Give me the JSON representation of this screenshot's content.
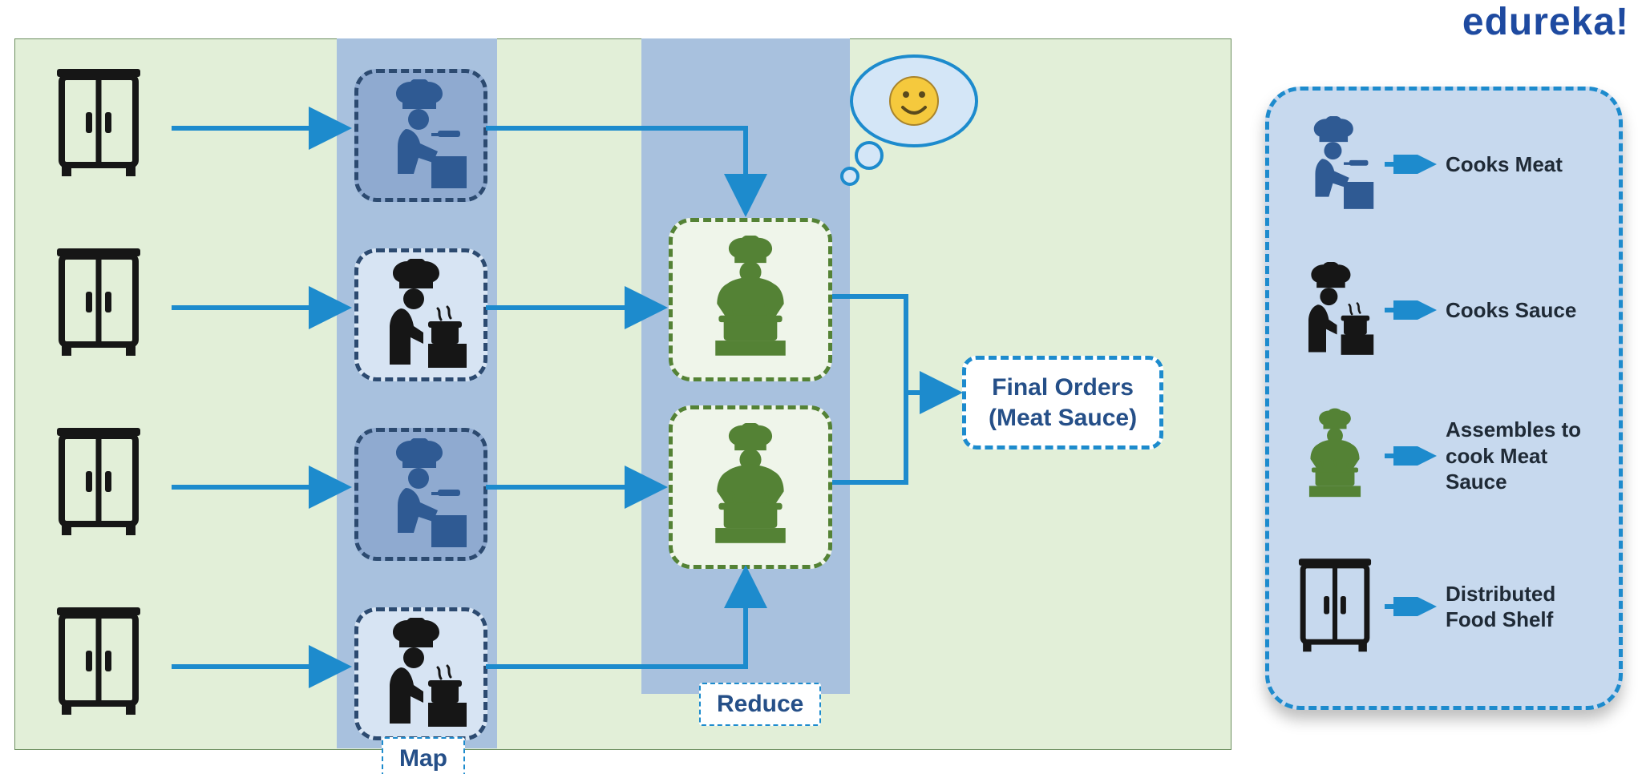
{
  "brand": "edureka!",
  "labels": {
    "map": "Map",
    "reduce": "Reduce",
    "final_l1": "Final Orders",
    "final_l2": "(Meat Sauce)"
  },
  "legend": [
    {
      "icon": "chef-blue",
      "text": "Cooks Meat"
    },
    {
      "icon": "chef-black",
      "text": "Cooks Sauce"
    },
    {
      "icon": "chef-green",
      "text": "Assembles to cook Meat Sauce"
    },
    {
      "icon": "cabinet",
      "text": "Distributed Food Shelf"
    }
  ],
  "watermark_word": "edureka!",
  "colors": {
    "accent": "#1d8bcd",
    "blue_dark": "#2f5a93",
    "green": "#548235",
    "black": "#161616"
  },
  "diagram": {
    "input_nodes": 4,
    "map_nodes": [
      "chef-blue",
      "chef-black",
      "chef-blue",
      "chef-black"
    ],
    "reduce_nodes": 2,
    "output": "Final Orders (Meat Sauce)"
  }
}
